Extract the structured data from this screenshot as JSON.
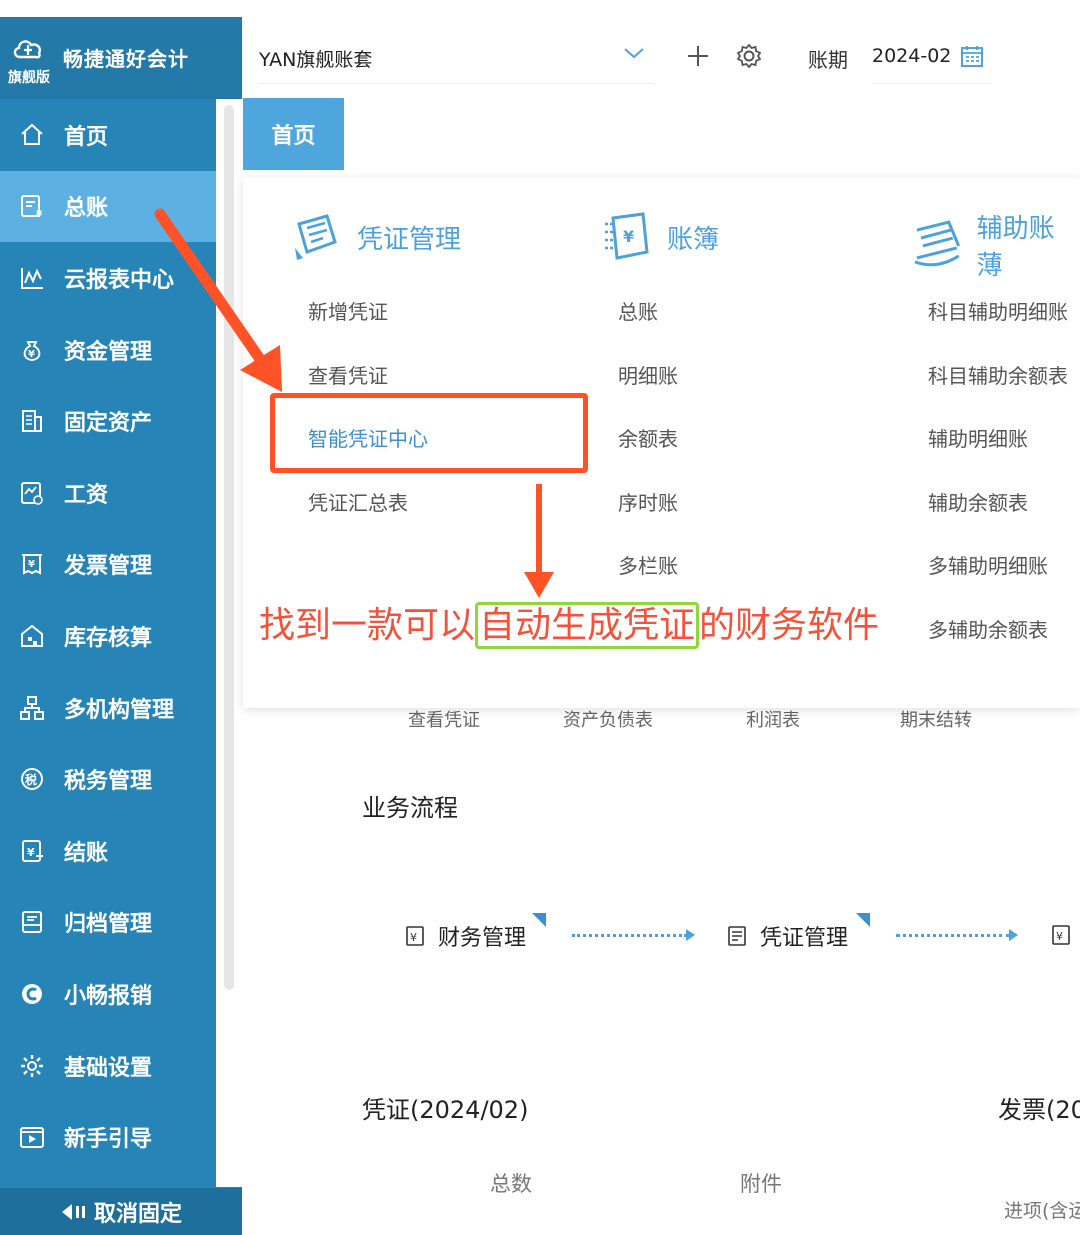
{
  "app": {
    "brand": "畅捷通好会计",
    "edition": "旗舰版"
  },
  "sidebar": {
    "items": [
      {
        "label": "首页",
        "icon": "home-icon"
      },
      {
        "label": "总账",
        "icon": "ledger-icon"
      },
      {
        "label": "云报表中心",
        "icon": "report-chart-icon"
      },
      {
        "label": "资金管理",
        "icon": "money-bag-icon"
      },
      {
        "label": "固定资产",
        "icon": "building-icon"
      },
      {
        "label": "工资",
        "icon": "salary-icon"
      },
      {
        "label": "发票管理",
        "icon": "invoice-icon"
      },
      {
        "label": "库存核算",
        "icon": "warehouse-icon"
      },
      {
        "label": "多机构管理",
        "icon": "org-tree-icon"
      },
      {
        "label": "税务管理",
        "icon": "tax-icon"
      },
      {
        "label": "结账",
        "icon": "checkout-icon"
      },
      {
        "label": "归档管理",
        "icon": "archive-icon"
      },
      {
        "label": "小畅报销",
        "icon": "reimburse-icon"
      },
      {
        "label": "基础设置",
        "icon": "gear-icon"
      },
      {
        "label": "新手引导",
        "icon": "video-guide-icon"
      }
    ],
    "active_index": 1,
    "unpin_label": "取消固定"
  },
  "header": {
    "account_name": "YAN旗舰账套",
    "period_label": "账期",
    "period_value": "2024-02"
  },
  "tabs": {
    "home": "首页"
  },
  "menu": {
    "columns": [
      {
        "title": "凭证管理",
        "items": [
          "新增凭证",
          "查看凭证",
          "智能凭证中心",
          "凭证汇总表"
        ]
      },
      {
        "title": "账簿",
        "items": [
          "总账",
          "明细账",
          "余额表",
          "序时账",
          "多栏账"
        ]
      },
      {
        "title": "辅助账薄",
        "items": [
          "科目辅助明细账",
          "科目辅助余额表",
          "辅助明细账",
          "辅助余额表",
          "多辅助明细账",
          "多辅助余额表"
        ]
      }
    ]
  },
  "annotation": {
    "caption_before": "找到一款可以",
    "caption_highlight": "自动生成凭证",
    "caption_after": "的财务软件",
    "accent_red": "#ff5227",
    "accent_green": "#8dd93a"
  },
  "main": {
    "quick_links": [
      "查看凭证",
      "资产负债表",
      "利润表",
      "期末结转"
    ],
    "flow_title": "业务流程",
    "flow_steps": [
      "财务管理",
      "凭证管理"
    ],
    "voucher_title": "凭证(2024/02)",
    "invoice_title": "发票(20",
    "stat_total": "总数",
    "stat_attach": "附件",
    "stat_input": "进项(含运"
  },
  "colors": {
    "sidebar": "#2784b6",
    "sidebar_active": "#5db1e2",
    "brand_blue": "#4da2db"
  }
}
